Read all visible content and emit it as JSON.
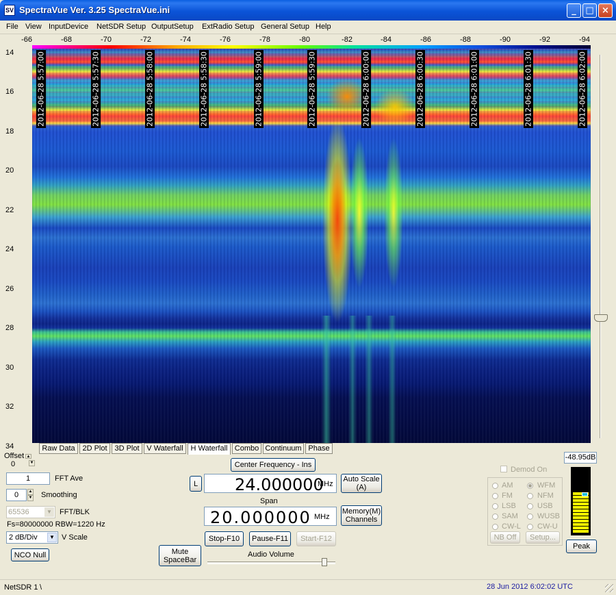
{
  "window": {
    "title": "SpectraVue Ver. 3.25  SpectraVue.ini",
    "icon_text": "SV",
    "controls": [
      "_",
      "□",
      "×"
    ]
  },
  "menu": [
    "File",
    "View",
    "InputDevice",
    "NetSDR Setup",
    "OutputSetup",
    "ExtRadio Setup",
    "General Setup",
    "Help"
  ],
  "top_axis": [
    "-66",
    "-68",
    "-70",
    "-72",
    "-74",
    "-76",
    "-78",
    "-80",
    "-82",
    "-84",
    "-86",
    "-88",
    "-90",
    "-92",
    "-94"
  ],
  "left_axis": [
    "14",
    "16",
    "18",
    "20",
    "22",
    "24",
    "26",
    "28",
    "30",
    "32",
    "34"
  ],
  "timestamps": [
    "2012-06-28 5:57:00",
    "2012-06-28 5:57:30",
    "2012-06-28 5:58:00",
    "2012-06-28 5:58:30",
    "2012-06-28 5:59:00",
    "2012-06-28 5:59:30",
    "2012-06-28 6:00:00",
    "2012-06-28 6:00:30",
    "2012-06-28 6:01:00",
    "2012-06-28 6:01:30",
    "2012-06-28 6:02:00"
  ],
  "tabs": [
    "Raw Data",
    "2D Plot",
    "3D Plot",
    "V Waterfall",
    "H Waterfall",
    "Combo",
    "Continuum",
    "Phase"
  ],
  "active_tab": "H Waterfall",
  "controls": {
    "offset_label": "Offset",
    "offset_value": "0",
    "fft_ave_value": "1",
    "fft_ave_label": "FFT Ave",
    "smoothing_value": "0",
    "smoothing_label": "Smoothing",
    "fft_blk_value": "65536",
    "fft_blk_label": "FFT/BLK",
    "fs_text": "Fs=80000000 RBW=1220 Hz",
    "vscale_value": "2 dB/Div",
    "vscale_label": "V Scale",
    "nco_null": "NCO Null",
    "center_freq_button": "Center Frequency - Ins",
    "l_button": "L",
    "center_freq_value": "24.000000",
    "center_freq_unit": "MHz",
    "auto_scale": "Auto Scale\n(A)",
    "span_label": "Span",
    "span_value": "20.000000",
    "span_unit": "MHz",
    "memory_button": "Memory(M)\nChannels",
    "stop_button": "Stop-F10",
    "pause_button": "Pause-F11",
    "start_button": "Start-F12",
    "mute_button": "Mute\nSpaceBar",
    "audio_volume_label": "Audio Volume",
    "audio_volume_level": 0.95,
    "level_value": "-48.95dB",
    "demod_label": "Demod On",
    "demod_modes_left": [
      "AM",
      "FM",
      "LSB",
      "SAM",
      "CW-L"
    ],
    "demod_modes_right": [
      "WFM",
      "NFM",
      "USB",
      "WUSB",
      "CW-U"
    ],
    "selected_mode": "WFM",
    "nb_off": "NB Off",
    "setup": "Setup...",
    "peak_button": "Peak",
    "meter_level": 0.63
  },
  "status": {
    "device": "NetSDR 1",
    "sep": "\\",
    "datetime": "28 Jun 2012  6:02:02 UTC"
  },
  "colors": {
    "title_bar": "#0a5fe0",
    "waterfall_background": "#1a3fc0",
    "meter_fill": "#ffff00",
    "status_datetime": "#1a1aa0"
  }
}
